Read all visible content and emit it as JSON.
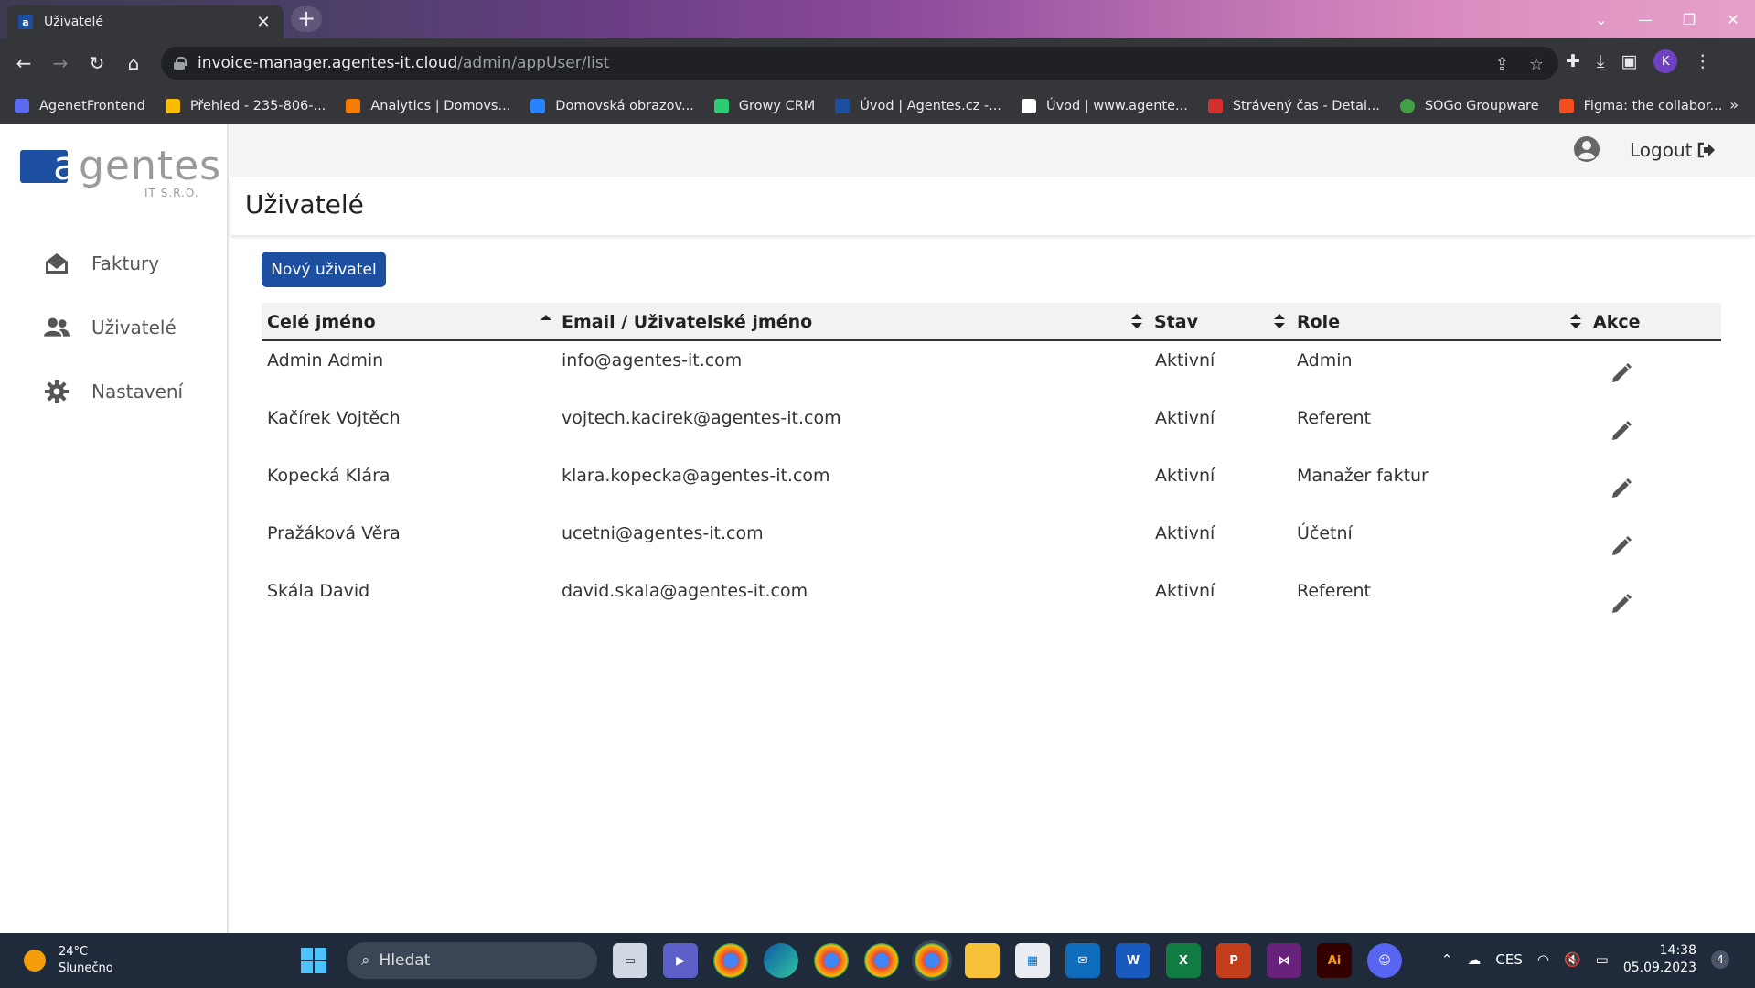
{
  "browser": {
    "tab_title": "Uživatelé",
    "tab_favicon": "a",
    "url_host": "invoice-manager.agentes-it.cloud",
    "url_path": "/admin/appUser/list",
    "profile_initial": "K",
    "bookmarks": [
      {
        "label": "AgenetFrontend",
        "color": "#5b6cf0"
      },
      {
        "label": "Přehled - 235-806-...",
        "color": "#fbbc04"
      },
      {
        "label": "Analytics | Domovs...",
        "color": "#f57c00"
      },
      {
        "label": "Domovská obrazov...",
        "color": "#2684ff"
      },
      {
        "label": "Growy CRM",
        "color": "#2ecc71"
      },
      {
        "label": "Úvod | Agentes.cz -...",
        "color": "#1c4fa0"
      },
      {
        "label": "Úvod | www.agente...",
        "color": "#ffffff"
      },
      {
        "label": "Strávený čas - Detai...",
        "color": "#d32f2f"
      },
      {
        "label": "SOGo Groupware",
        "color": "#43a047"
      },
      {
        "label": "Figma: the collabor...",
        "color": "#f24e1e"
      }
    ]
  },
  "app": {
    "logo_text": "agentes",
    "logo_sub": "IT S.R.O.",
    "nav": [
      {
        "label": "Faktury",
        "icon": "envelope-open-icon"
      },
      {
        "label": "Uživatelé",
        "icon": "users-icon"
      },
      {
        "label": "Nastavení",
        "icon": "gear-icon"
      }
    ],
    "logout_label": "Logout",
    "page_title": "Uživatelé",
    "new_user_label": "Nový uživatel",
    "accent": "#1c4fa0"
  },
  "table": {
    "headers": {
      "name": "Celé jméno",
      "email": "Email / Uživatelské jméno",
      "status": "Stav",
      "role": "Role",
      "actions": "Akce"
    },
    "rows": [
      {
        "name": "Admin Admin",
        "email": "info@agentes-it.com",
        "status": "Aktivní",
        "role": "Admin"
      },
      {
        "name": "Kačírek Vojtěch",
        "email": "vojtech.kacirek@agentes-it.com",
        "status": "Aktivní",
        "role": "Referent"
      },
      {
        "name": "Kopecká Klára",
        "email": "klara.kopecka@agentes-it.com",
        "status": "Aktivní",
        "role": "Manažer faktur"
      },
      {
        "name": "Pražáková Věra",
        "email": "ucetni@agentes-it.com",
        "status": "Aktivní",
        "role": "Účetní"
      },
      {
        "name": "Skála David",
        "email": "david.skala@agentes-it.com",
        "status": "Aktivní",
        "role": "Referent"
      }
    ]
  },
  "taskbar": {
    "temperature": "24°C",
    "weather": "Slunečno",
    "search_placeholder": "Hledat",
    "language": "CES",
    "time": "14:38",
    "date": "05.09.2023",
    "notifications": "4"
  }
}
